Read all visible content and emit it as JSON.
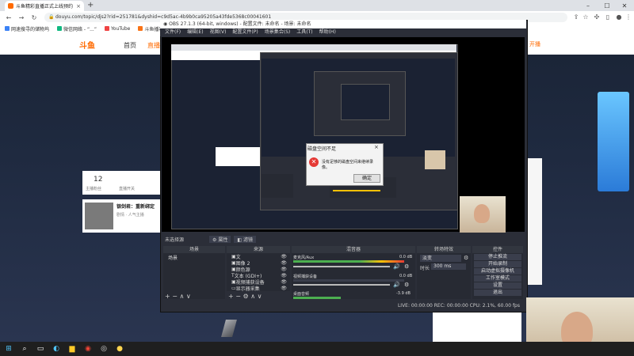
{
  "browser": {
    "tab_title": "斗鱼精彩直播正式上线预约",
    "tab_close": "×",
    "new_tab": "+",
    "url": "douyu.com/topic/djs2?rid=251781&dyshid=c9d5ac-4b9b0ca95205a43fde5368c00041601",
    "bookmarks": [
      {
        "label": "网速搜寻的储物坞",
        "color": "#3b82f6"
      },
      {
        "label": "微信网络 - “...”",
        "color": "#10b981"
      },
      {
        "label": "YouTube",
        "color": "#ef4444"
      },
      {
        "label": "斗鱼播客首页",
        "color": "#f97316"
      }
    ]
  },
  "douyu": {
    "nav": [
      "首页",
      "直播"
    ],
    "start_broadcast": "开播",
    "follow_count": "12",
    "follow_label": "主播粉丝",
    "hot_label": "直播开关",
    "streamer_name": "银剑君：重新绑定",
    "streamer_tag": "剧情 · 人气主播"
  },
  "obs": {
    "title": "OBS 27.1.3 (64-bit, windows) - 配置文件: 未命名 - 场景: 未命名",
    "menu": [
      "文件(F)",
      "编辑(E)",
      "视图(V)",
      "配置文件(P)",
      "场景集合(S)",
      "工具(T)",
      "帮助(H)"
    ],
    "no_source_label": "未选择源",
    "props_btn": "属性",
    "filters_btn": "滤镜",
    "docks": {
      "scenes": "场景",
      "sources": "来源",
      "mixer": "混音器",
      "transitions": "转场特效",
      "controls": "控件"
    },
    "scene_item": "场景",
    "sources": [
      "文",
      "图像 2",
      "颜色源",
      "文本 (GDI+)",
      "视频捕获设备",
      "显示器采集"
    ],
    "mixer": [
      {
        "name": "麦克风/Aux",
        "db": "0.0 dB"
      },
      {
        "name": "视频捕获设备",
        "db": "0.0 dB"
      },
      {
        "name": "桌面音频",
        "db": "-3.9 dB"
      }
    ],
    "transition": "淡变",
    "duration_label": "时长",
    "duration_value": "300 ms",
    "controls": [
      "停止推流",
      "开始录制",
      "启动虚拟摄像机",
      "工作室模式",
      "设置",
      "退出"
    ],
    "status": "LIVE: 00:00:00  REC: 00:00:00  CPU: 2.1%, 60.00 fps",
    "dialog": {
      "title": "磁盘空间不足",
      "message": "没有足够的磁盘空间来继续录像。",
      "ok": "确定",
      "close": "×"
    }
  },
  "taskbar": {
    "icons": [
      "windows-icon",
      "search-icon",
      "task-view-icon",
      "edge-icon",
      "folder-icon",
      "chrome-icon",
      "obs-icon",
      "app-icon"
    ]
  },
  "colors": {
    "accent": "#ff6a00",
    "obs_bg": "#2b2e38",
    "error_red": "#e53935",
    "meter_green": "#4caf50",
    "meter_yellow": "#ffc107"
  }
}
